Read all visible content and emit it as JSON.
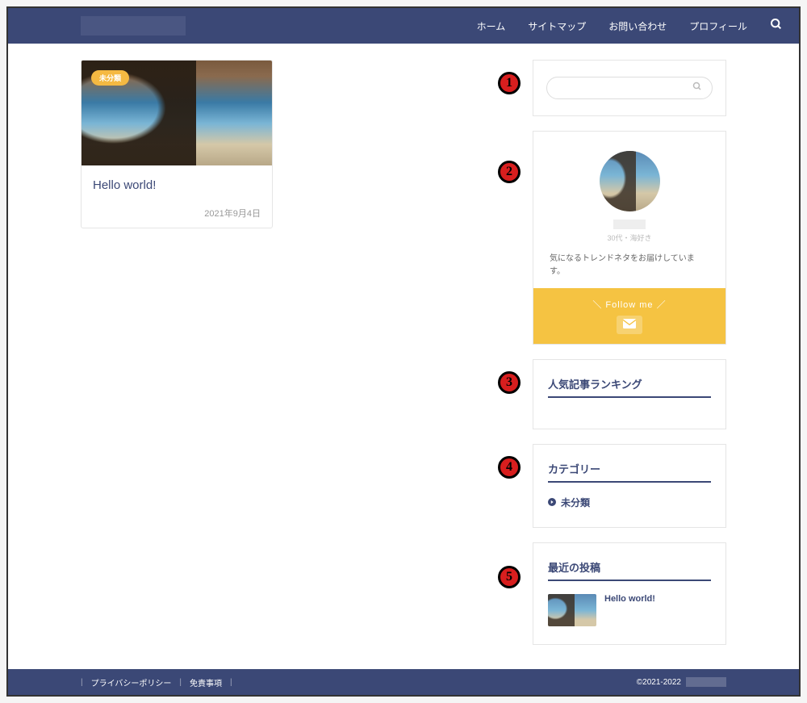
{
  "nav": {
    "items": [
      "ホーム",
      "サイトマップ",
      "お問い合わせ",
      "プロフィール"
    ]
  },
  "post": {
    "badge": "未分類",
    "title": "Hello world!",
    "date": "2021年9月4日"
  },
  "profile": {
    "sub": "30代・海好き",
    "desc": "気になるトレンドネタをお届けしています。",
    "follow_label": "＼ Follow me ／"
  },
  "widgets": {
    "ranking_title": "人気記事ランキング",
    "category_title": "カテゴリー",
    "category_item": "未分類",
    "recent_title": "最近の投稿",
    "recent_item": "Hello world!"
  },
  "markers": [
    "1",
    "2",
    "3",
    "4",
    "5"
  ],
  "footer": {
    "links": [
      "プライバシーポリシー",
      "免責事項"
    ],
    "copyright": "©2021-2022"
  }
}
